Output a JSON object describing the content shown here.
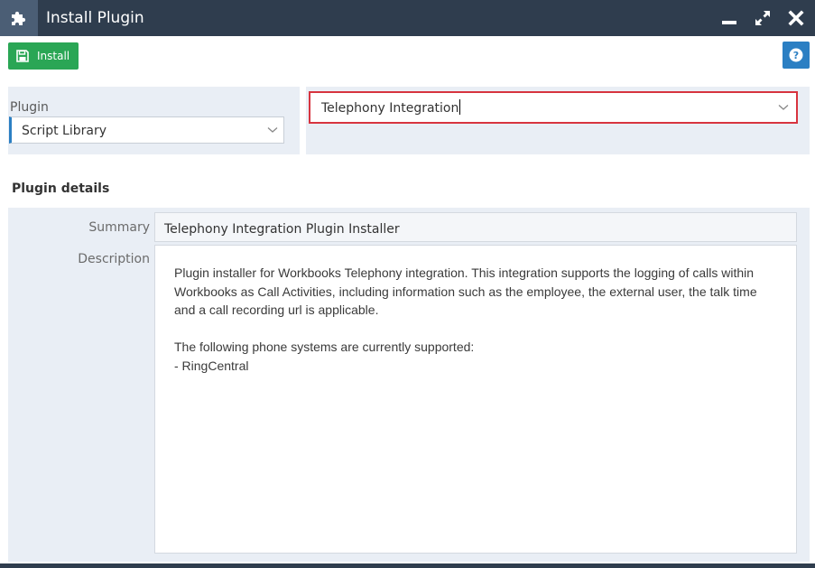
{
  "window": {
    "title": "Install Plugin",
    "icon": "puzzle-icon",
    "controls": [
      "minimize-icon",
      "maximize-icon",
      "close-icon"
    ]
  },
  "toolbar": {
    "install_label": "Install",
    "install_icon": "save-icon",
    "help_icon": "help-icon"
  },
  "plugin": {
    "label": "Plugin",
    "selected": "Script Library",
    "variant_selected": "Telephony Integration"
  },
  "details": {
    "heading": "Plugin details",
    "summary_label": "Summary",
    "summary_value": "Telephony Integration Plugin Installer",
    "description_label": "Description",
    "description_lines": [
      "Plugin installer for Workbooks Telephony integration. This integration supports the logging of calls within Workbooks as Call Activities, including information such as the employee, the external user, the talk time and a call recording url is applicable.",
      "",
      "The following phone systems are currently supported:",
      "- RingCentral"
    ]
  },
  "colors": {
    "titlebar": "#2f3d4e",
    "install_button": "#2aa655",
    "help_button": "#2b7fc3",
    "panel_bg": "#e9eef5",
    "focus_border": "#d7343f"
  }
}
